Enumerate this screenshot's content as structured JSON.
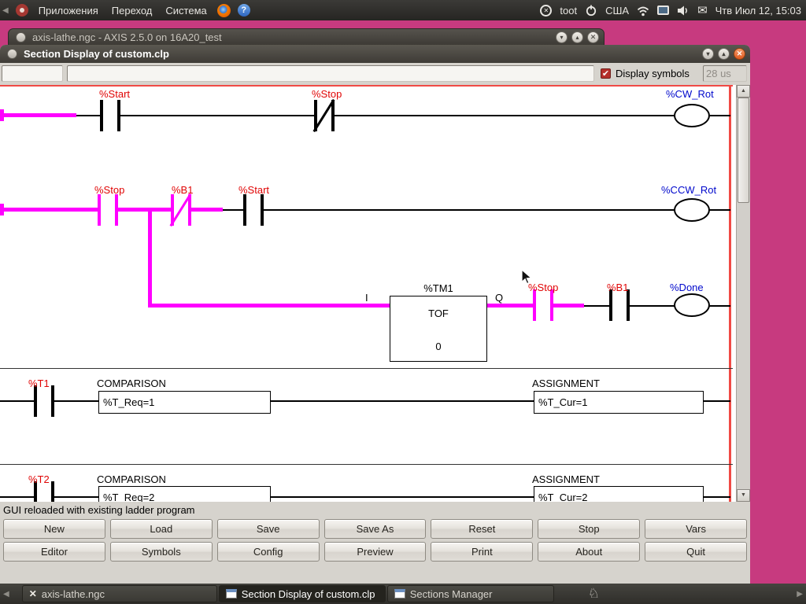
{
  "top_panel": {
    "menus": [
      "Приложения",
      "Переход",
      "Система"
    ],
    "username": "toot",
    "keyboard_layout": "США",
    "clock": "Чтв Июл 12, 15:03"
  },
  "axis_window": {
    "title": "axis-lathe.ngc - AXIS 2.5.0 on 16A20_test"
  },
  "ladder_window": {
    "title": "Section Display of custom.clp",
    "toolbar": {
      "entry1": "",
      "entry2": "",
      "display_symbols_label": "Display symbols",
      "scan_time": "28 us"
    },
    "status": "GUI reloaded with existing ladder program",
    "buttons_row1": [
      "New",
      "Load",
      "Save",
      "Save As",
      "Reset",
      "Stop",
      "Vars"
    ],
    "buttons_row2": [
      "Editor",
      "Symbols",
      "Config",
      "Preview",
      "Print",
      "About",
      "Quit"
    ]
  },
  "ladder": {
    "rung1": {
      "contact1": "%Start",
      "contact2": "%Stop",
      "coil": "%CW_Rot"
    },
    "rung2": {
      "contact1": "%Stop",
      "contact2": "%B1",
      "contact3": "%Start",
      "coil": "%CCW_Rot"
    },
    "timer": {
      "name": "%TM1",
      "type": "TOF",
      "preset": "0",
      "input_label": "I",
      "output_label": "Q"
    },
    "branch": {
      "contact1": "%Stop",
      "contact2": "%B1",
      "coil": "%Done"
    },
    "rung3": {
      "contact": "%T1",
      "comparison_title": "COMPARISON",
      "comparison_expr": "%T_Req=1",
      "assignment_title": "ASSIGNMENT",
      "assignment_expr": "%T_Cur=1"
    },
    "rung4": {
      "contact": "%T2",
      "comparison_title": "COMPARISON",
      "comparison_expr": "%T_Req=2",
      "assignment_title": "ASSIGNMENT",
      "assignment_expr": "%T_Cur=2"
    }
  },
  "taskbar": {
    "items": [
      {
        "label": "axis-lathe.ngc"
      },
      {
        "label": "Section Display of custom.clp"
      },
      {
        "label": "Sections Manager"
      }
    ]
  },
  "colors": {
    "energized": "#ff00ff",
    "contact_label": "#e00505",
    "coil_label": "#0008cc",
    "power_rail": "#f04a45",
    "desktop": "#c73a7f"
  }
}
